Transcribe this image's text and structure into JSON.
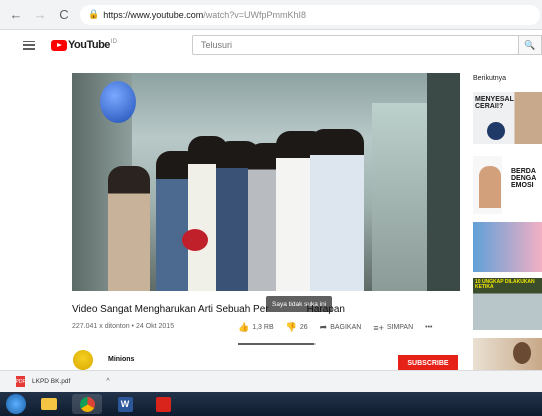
{
  "browser": {
    "url_host": "https://www.youtube.com",
    "url_path": "/watch?v=UWfpPmmKhI8"
  },
  "masthead": {
    "logo_text": "YouTube",
    "logo_region": "ID",
    "search_placeholder": "Telusuri"
  },
  "video": {
    "title_start": "Video Sangat Mengharukan Arti Sebuah Per",
    "title_end": "Harapan",
    "views": "227.041 x ditonton • 24 Okt 2015",
    "likes": "1,3 RB",
    "dislikes": "26",
    "share_label": "BAGIKAN",
    "save_label": "SIMPAN",
    "more_label": "•••",
    "tooltip": "Saya tidak suka ini",
    "like_ratio": 0.98
  },
  "channel": {
    "name": "Minions",
    "subscribe_label": "SUBSCRIBE"
  },
  "sidebar": {
    "up_next_label": "Berikutnya",
    "thumbs": [
      {
        "text": "MENYESAL CERAI!?"
      },
      {
        "text": "BERDA DENGA EMOSI"
      },
      {
        "text": ""
      },
      {
        "text": "10 UNGKAP DILAKUKAN KETIKA"
      },
      {
        "text": ""
      }
    ]
  },
  "download": {
    "file_name": "LKPD BK.pdf",
    "file_type": "PDF"
  },
  "colors": {
    "brand_red": "#ff0000",
    "subscribe_red": "#e62117"
  }
}
